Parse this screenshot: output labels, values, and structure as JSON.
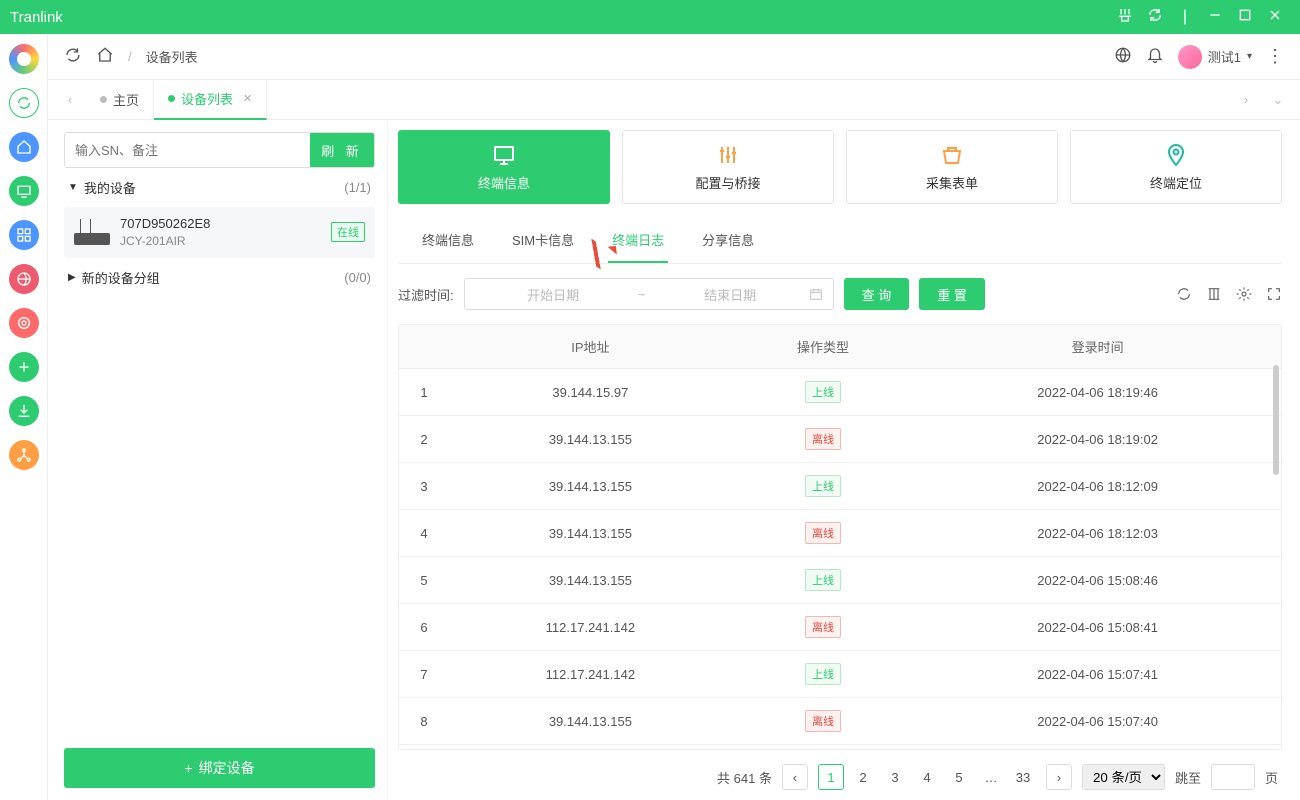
{
  "app_title": "Tranlink",
  "breadcrumb": {
    "home_icon": "home",
    "page": "设备列表"
  },
  "user": {
    "name": "测试1"
  },
  "page_tabs": [
    {
      "label": "主页",
      "active": false
    },
    {
      "label": "设备列表",
      "active": true
    }
  ],
  "sidebar": {
    "search_placeholder": "输入SN、备注",
    "refresh_btn": "刷 新",
    "groups": [
      {
        "name": "我的设备",
        "count": "(1/1)",
        "devices": [
          {
            "sn": "707D950262E8",
            "model": "JCY-201AIR",
            "status": "在线"
          }
        ]
      },
      {
        "name": "新的设备分组",
        "count": "(0/0)",
        "devices": []
      }
    ],
    "bind_btn": "绑定设备"
  },
  "big_tabs": [
    {
      "label": "终端信息",
      "active": true
    },
    {
      "label": "配置与桥接",
      "active": false
    },
    {
      "label": "采集表单",
      "active": false
    },
    {
      "label": "终端定位",
      "active": false
    }
  ],
  "sub_tabs": [
    {
      "label": "终端信息",
      "active": false
    },
    {
      "label": "SIM卡信息",
      "active": false
    },
    {
      "label": "终端日志",
      "active": true
    },
    {
      "label": "分享信息",
      "active": false
    }
  ],
  "filter": {
    "label": "过滤时间:",
    "start_ph": "开始日期",
    "end_ph": "结束日期",
    "query": "查 询",
    "reset": "重 置"
  },
  "table": {
    "headers": [
      "",
      "IP地址",
      "操作类型",
      "登录时间"
    ],
    "rows": [
      {
        "idx": "1",
        "ip": "39.144.15.97",
        "type": "上线",
        "type_cls": "online",
        "time": "2022-04-06 18:19:46"
      },
      {
        "idx": "2",
        "ip": "39.144.13.155",
        "type": "离线",
        "type_cls": "offline",
        "time": "2022-04-06 18:19:02"
      },
      {
        "idx": "3",
        "ip": "39.144.13.155",
        "type": "上线",
        "type_cls": "online",
        "time": "2022-04-06 18:12:09"
      },
      {
        "idx": "4",
        "ip": "39.144.13.155",
        "type": "离线",
        "type_cls": "offline",
        "time": "2022-04-06 18:12:03"
      },
      {
        "idx": "5",
        "ip": "39.144.13.155",
        "type": "上线",
        "type_cls": "online",
        "time": "2022-04-06 15:08:46"
      },
      {
        "idx": "6",
        "ip": "112.17.241.142",
        "type": "离线",
        "type_cls": "offline",
        "time": "2022-04-06 15:08:41"
      },
      {
        "idx": "7",
        "ip": "112.17.241.142",
        "type": "上线",
        "type_cls": "online",
        "time": "2022-04-06 15:07:41"
      },
      {
        "idx": "8",
        "ip": "39.144.13.155",
        "type": "离线",
        "type_cls": "offline",
        "time": "2022-04-06 15:07:40"
      }
    ]
  },
  "pagination": {
    "total_label": "共 641 条",
    "pages": [
      "1",
      "2",
      "3",
      "4",
      "5",
      "…",
      "33"
    ],
    "current": "1",
    "page_size": "20 条/页",
    "jump_label": "跳至",
    "jump_suffix": "页"
  }
}
